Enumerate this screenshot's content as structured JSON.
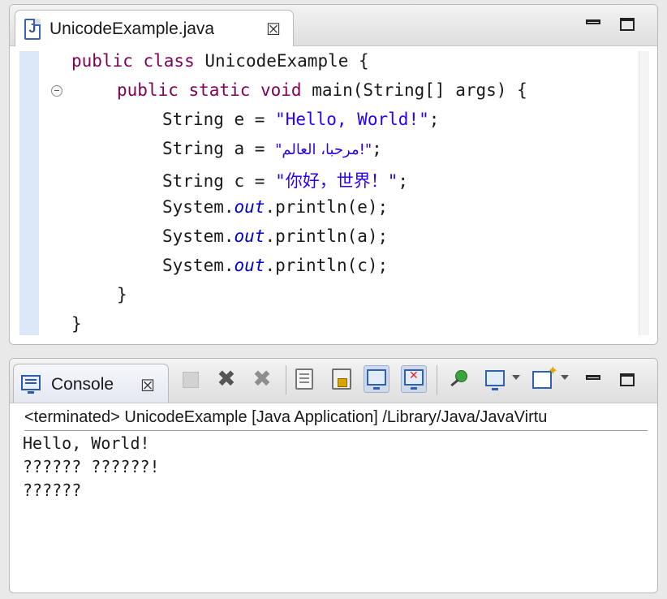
{
  "editor": {
    "tab_title": "UnicodeExample.java",
    "tab_icon": "java-file-icon",
    "code": {
      "line1_kw": "public class ",
      "line1_rest": "UnicodeExample {",
      "line2_kw": "public static void ",
      "line2_rest": "main(String[] args) {",
      "line3_pre": "String e = ",
      "line3_str": "\"Hello, World!\"",
      "line3_post": ";",
      "line4_pre": "String a = ",
      "line4_str": "\"!مرحبا، العالم\"",
      "line4_post": ";",
      "line5_pre": "String c = ",
      "line5_str": "\"你好，世界！\"",
      "line5_post": ";",
      "line6_pre": "System.",
      "line6_fld": "out",
      "line6_post": ".println(e);",
      "line7_pre": "System.",
      "line7_fld": "out",
      "line7_post": ".println(a);",
      "line8_pre": "System.",
      "line8_fld": "out",
      "line8_post": ".println(c);",
      "line9": "}",
      "line10": "}"
    },
    "colors": {
      "keyword": "#7f0055",
      "string": "#2a00ff",
      "field": "#0000c0"
    }
  },
  "console": {
    "tab_title": "Console",
    "tab_icon": "console-monitor-icon",
    "status": "<terminated> UnicodeExample [Java Application] /Library/Java/JavaVirtu",
    "output": [
      "Hello, World!",
      "?????? ??????!",
      "??????"
    ],
    "toolbar_icons": [
      "terminate-icon",
      "remove-launch-icon",
      "remove-all-terminated-icon",
      "scroll-lock-icon",
      "word-wrap-lock-icon",
      "show-console-on-stdout-icon",
      "show-console-on-stderr-icon",
      "pin-console-icon",
      "display-selected-console-icon",
      "open-console-icon",
      "minimize-icon",
      "maximize-icon"
    ]
  }
}
